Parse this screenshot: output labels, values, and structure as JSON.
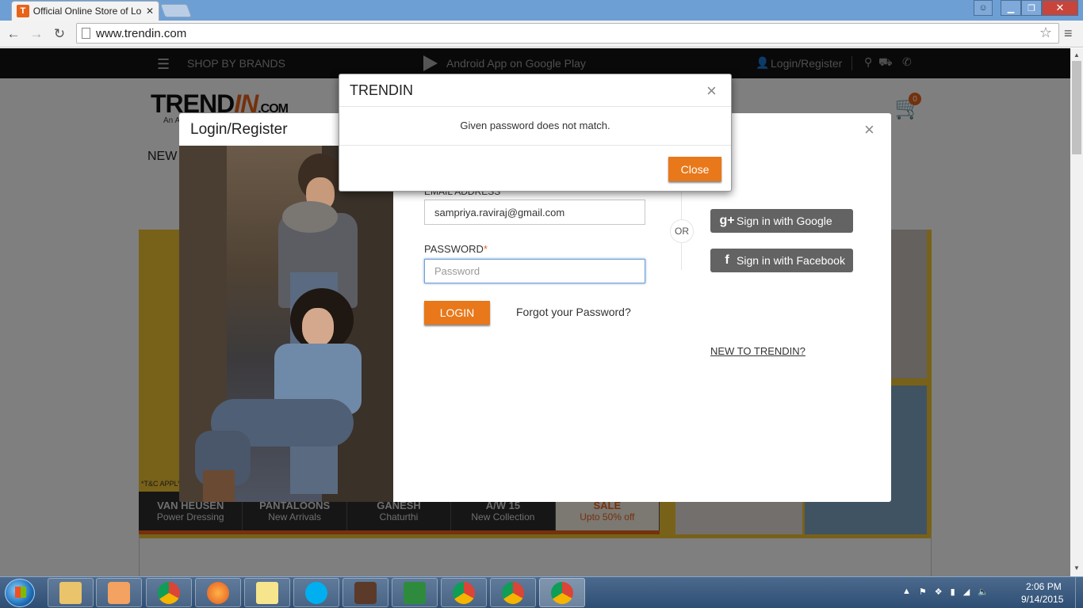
{
  "browser": {
    "tab_title": "Official Online Store of Lo",
    "tab_favicon_letter": "T",
    "url": "www.trendin.com"
  },
  "site": {
    "topbar": {
      "shop_by_brands": "SHOP BY BRANDS",
      "android_app": "Android App on Google Play",
      "login_register": "Login/Register"
    },
    "logo_text": "TREND",
    "logo_text_in": "IN",
    "logo_text_com": ".COM",
    "logo_sub": "An A",
    "cart_count": "0",
    "nav_first": "NEW",
    "tnc": "*T&C APPLY",
    "strip": [
      {
        "title": "VAN HEUSEN",
        "sub": "Power Dressing"
      },
      {
        "title": "PANTALOONS",
        "sub": "New Arrivals"
      },
      {
        "title": "GANESH",
        "sub": "Chaturthi"
      },
      {
        "title": "A/W 15",
        "sub": "New Collection"
      },
      {
        "title": "SALE",
        "sub": "Upto 50% off"
      }
    ]
  },
  "login_modal": {
    "title": "Login/Register",
    "email_label": "EMAIL ADDRESS",
    "email_value": "sampriya.raviraj@gmail.com",
    "password_label": "PASSWORD",
    "password_required": "*",
    "password_placeholder": "Password",
    "login_button": "LOGIN",
    "forgot_link": "Forgot your Password?",
    "or_text": "OR",
    "google_button": "Sign in with Google",
    "facebook_button": "Sign in with Facebook",
    "new_to": "NEW TO TRENDIN?"
  },
  "alert_modal": {
    "title": "TRENDIN",
    "message": "Given password does not match.",
    "close_button": "Close"
  },
  "taskbar": {
    "time": "2:06 PM",
    "date": "9/14/2015"
  },
  "colors": {
    "accent": "#e8781a",
    "social_button": "#646363",
    "site_topbar": "#131313"
  }
}
